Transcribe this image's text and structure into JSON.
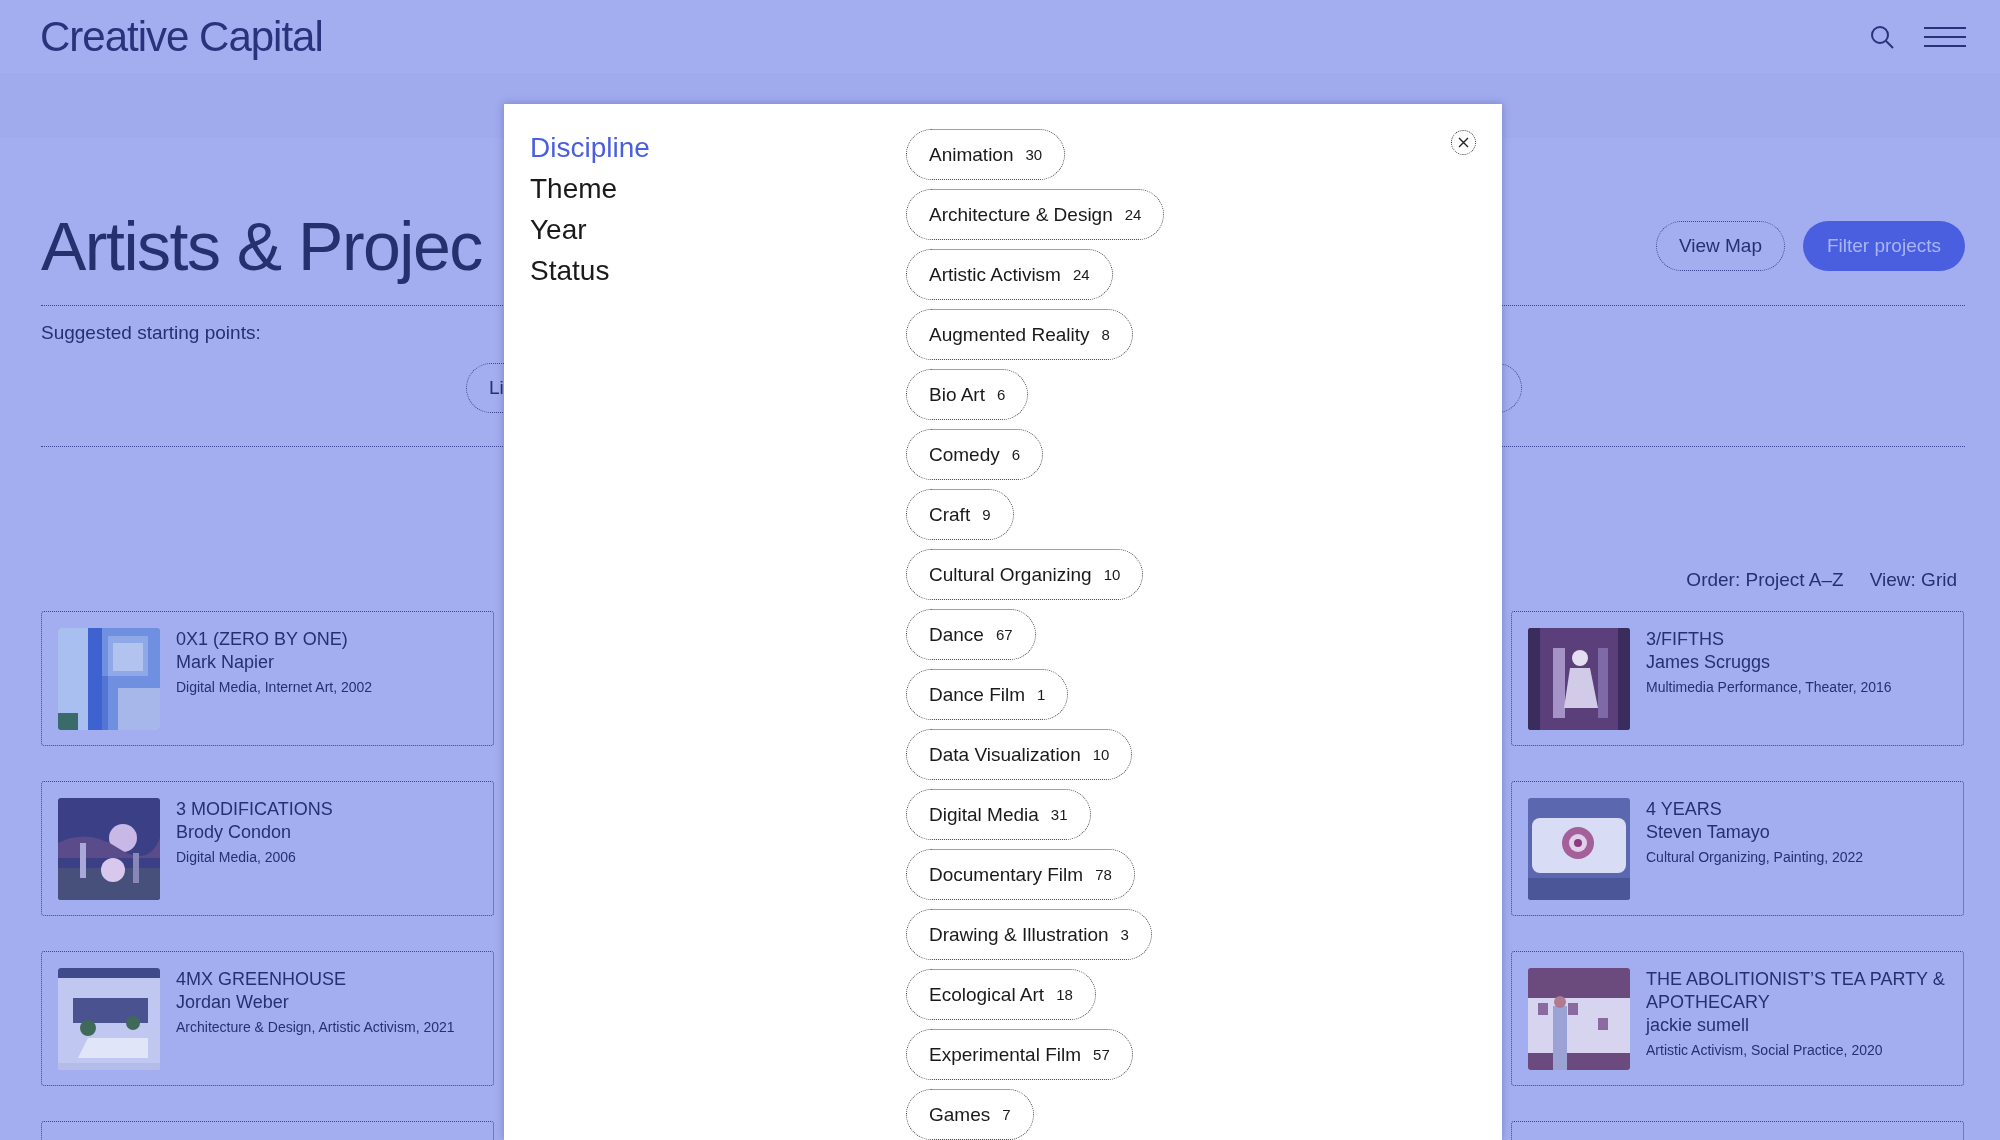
{
  "header": {
    "logo": "Creative Capital"
  },
  "page": {
    "title": "Artists & Projec",
    "view_map": "View Map",
    "filter_button": "Filter projects",
    "suggested_label": "Suggested starting points:",
    "suggestions": [
      "Li"
    ],
    "order": "Order: Project A–Z",
    "view": "View: Grid"
  },
  "project_columns": [
    {
      "cards": [
        {
          "kind": "project",
          "title": "0X1 (ZERO BY ONE)",
          "artist": "Mark Napier",
          "tags": "Digital Media, Internet Art, 2002"
        },
        {
          "kind": "project",
          "title": "3 MODIFICATIONS",
          "artist": "Brody Condon",
          "tags": "Digital Media, 2006"
        },
        {
          "kind": "project",
          "title": "4MX GREENHOUSE",
          "artist": "Jordan Weber",
          "tags": "Architecture & Design, Artistic Activism, 2021"
        },
        {
          "kind": "cut"
        }
      ]
    },
    {
      "cards": [
        {
          "kind": "project",
          "title": "3/FIFTHS",
          "artist": "James Scruggs",
          "tags": "Multimedia Performance, Theater, 2016"
        },
        {
          "kind": "project",
          "title": "4 YEARS",
          "artist": "Steven Tamayo",
          "tags": "Cultural Organizing, Painting, 2022"
        },
        {
          "kind": "project",
          "title": "THE ABOLITIONIST’S TEA PARTY & APOTHECARY",
          "artist": "jackie sumell",
          "tags": "Artistic Activism, Social Practice, 2020"
        },
        {
          "kind": "cut"
        }
      ]
    }
  ],
  "modal": {
    "tabs": [
      {
        "label": "Discipline",
        "selected": true
      },
      {
        "label": "Theme",
        "selected": false
      },
      {
        "label": "Year",
        "selected": false
      },
      {
        "label": "Status",
        "selected": false
      }
    ],
    "options": [
      {
        "label": "Animation",
        "count": "30"
      },
      {
        "label": "Architecture & Design",
        "count": "24"
      },
      {
        "label": "Artistic Activism",
        "count": "24"
      },
      {
        "label": "Augmented Reality",
        "count": "8"
      },
      {
        "label": "Bio Art",
        "count": "6"
      },
      {
        "label": "Comedy",
        "count": "6"
      },
      {
        "label": "Craft",
        "count": "9"
      },
      {
        "label": "Cultural Organizing",
        "count": "10"
      },
      {
        "label": "Dance",
        "count": "67"
      },
      {
        "label": "Dance Film",
        "count": "1"
      },
      {
        "label": "Data Visualization",
        "count": "10"
      },
      {
        "label": "Digital Media",
        "count": "31"
      },
      {
        "label": "Documentary Film",
        "count": "78"
      },
      {
        "label": "Drawing & Illustration",
        "count": "3"
      },
      {
        "label": "Ecological Art",
        "count": "18"
      },
      {
        "label": "Experimental Film",
        "count": "57"
      },
      {
        "label": "Games",
        "count": "7"
      }
    ]
  }
}
